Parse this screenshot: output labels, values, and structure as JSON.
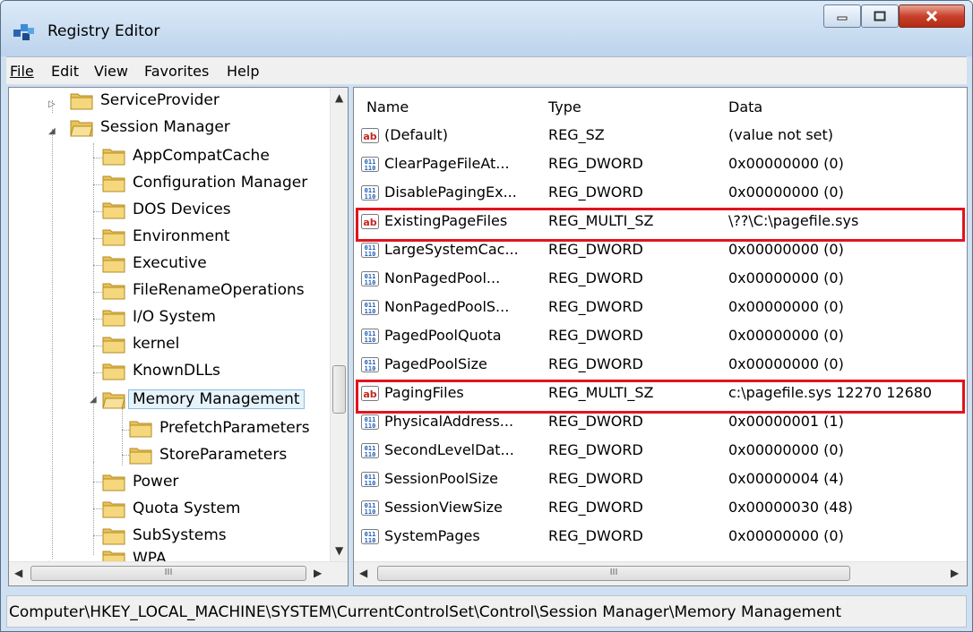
{
  "window": {
    "title": "Registry Editor"
  },
  "menu": [
    "File",
    "Edit",
    "View",
    "Favorites",
    "Help"
  ],
  "tree": [
    {
      "label": "ServiceProvider"
    },
    {
      "label": "Session Manager"
    },
    {
      "label": "AppCompatCache"
    },
    {
      "label": "Configuration Manager"
    },
    {
      "label": "DOS Devices"
    },
    {
      "label": "Environment"
    },
    {
      "label": "Executive"
    },
    {
      "label": "FileRenameOperations"
    },
    {
      "label": "I/O System"
    },
    {
      "label": "kernel"
    },
    {
      "label": "KnownDLLs"
    },
    {
      "label": "Memory Management"
    },
    {
      "label": "PrefetchParameters"
    },
    {
      "label": "StoreParameters"
    },
    {
      "label": "Power"
    },
    {
      "label": "Quota System"
    },
    {
      "label": "SubSystems"
    },
    {
      "label": "WPA"
    }
  ],
  "list": {
    "columns": [
      "Name",
      "Type",
      "Data"
    ],
    "rows": [
      {
        "icon": "string-value-icon",
        "name": "(Default)",
        "type": "REG_SZ",
        "data": "(value not set)"
      },
      {
        "icon": "binary-value-icon",
        "name": "ClearPageFileAt...",
        "type": "REG_DWORD",
        "data": "0x00000000 (0)"
      },
      {
        "icon": "binary-value-icon",
        "name": "DisablePagingEx...",
        "type": "REG_DWORD",
        "data": "0x00000000 (0)"
      },
      {
        "icon": "string-value-icon",
        "name": "ExistingPageFiles",
        "type": "REG_MULTI_SZ",
        "data": "\\??\\C:\\pagefile.sys"
      },
      {
        "icon": "binary-value-icon",
        "name": "LargeSystemCac...",
        "type": "REG_DWORD",
        "data": "0x00000000 (0)"
      },
      {
        "icon": "binary-value-icon",
        "name": "NonPagedPool...",
        "type": "REG_DWORD",
        "data": "0x00000000 (0)"
      },
      {
        "icon": "binary-value-icon",
        "name": "NonPagedPoolS...",
        "type": "REG_DWORD",
        "data": "0x00000000 (0)"
      },
      {
        "icon": "binary-value-icon",
        "name": "PagedPoolQuota",
        "type": "REG_DWORD",
        "data": "0x00000000 (0)"
      },
      {
        "icon": "binary-value-icon",
        "name": "PagedPoolSize",
        "type": "REG_DWORD",
        "data": "0x00000000 (0)"
      },
      {
        "icon": "string-value-icon",
        "name": "PagingFiles",
        "type": "REG_MULTI_SZ",
        "data": "c:\\pagefile.sys 12270 12680"
      },
      {
        "icon": "binary-value-icon",
        "name": "PhysicalAddress...",
        "type": "REG_DWORD",
        "data": "0x00000001 (1)"
      },
      {
        "icon": "binary-value-icon",
        "name": "SecondLevelDat...",
        "type": "REG_DWORD",
        "data": "0x00000000 (0)"
      },
      {
        "icon": "binary-value-icon",
        "name": "SessionPoolSize",
        "type": "REG_DWORD",
        "data": "0x00000004 (4)"
      },
      {
        "icon": "binary-value-icon",
        "name": "SessionViewSize",
        "type": "REG_DWORD",
        "data": "0x00000030 (48)"
      },
      {
        "icon": "binary-value-icon",
        "name": "SystemPages",
        "type": "REG_DWORD",
        "data": "0x00000000 (0)"
      }
    ]
  },
  "status": {
    "path": "Computer\\HKEY_LOCAL_MACHINE\\SYSTEM\\CurrentControlSet\\Control\\Session Manager\\Memory Management"
  },
  "colors": {
    "highlight": "#e0141e",
    "folder": "#e8c25a",
    "selection": "#e5f3fb"
  }
}
